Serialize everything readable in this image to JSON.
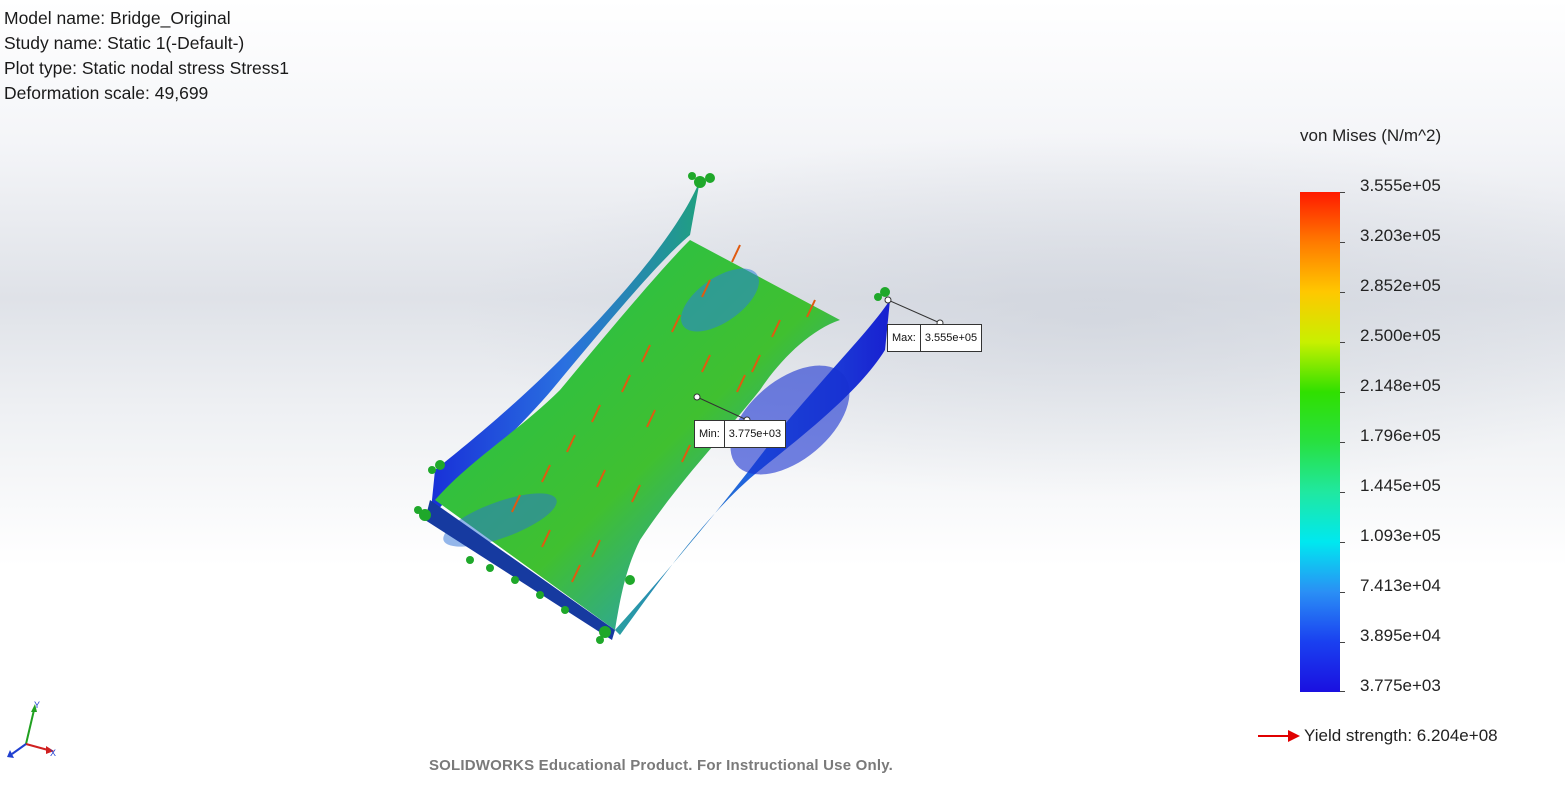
{
  "info": {
    "model_name": "Model name: Bridge_Original",
    "study_name": "Study name: Static 1(-Default-)",
    "plot_type": "Plot type: Static nodal stress Stress1",
    "deformation_scale": "Deformation scale: 49,699"
  },
  "legend": {
    "title": "von Mises (N/m^2)",
    "ticks": [
      "3.555e+05",
      "3.203e+05",
      "2.852e+05",
      "2.500e+05",
      "2.148e+05",
      "1.796e+05",
      "1.445e+05",
      "1.093e+05",
      "7.413e+04",
      "3.895e+04",
      "3.775e+03"
    ],
    "colors": {
      "max": "#ff1a00",
      "mid": "#30e000",
      "min": "#1a10e0"
    }
  },
  "yield": {
    "label": "Yield strength: 6.204e+08",
    "arrow_color": "#e00000"
  },
  "callouts": {
    "max_label": "Max:",
    "max_value": "3.555e+05",
    "min_label": "Min:",
    "min_value": "3.775e+03"
  },
  "triad": {
    "y": "Y",
    "x": "X"
  },
  "watermark": "SOLIDWORKS Educational Product. For Instructional Use Only."
}
